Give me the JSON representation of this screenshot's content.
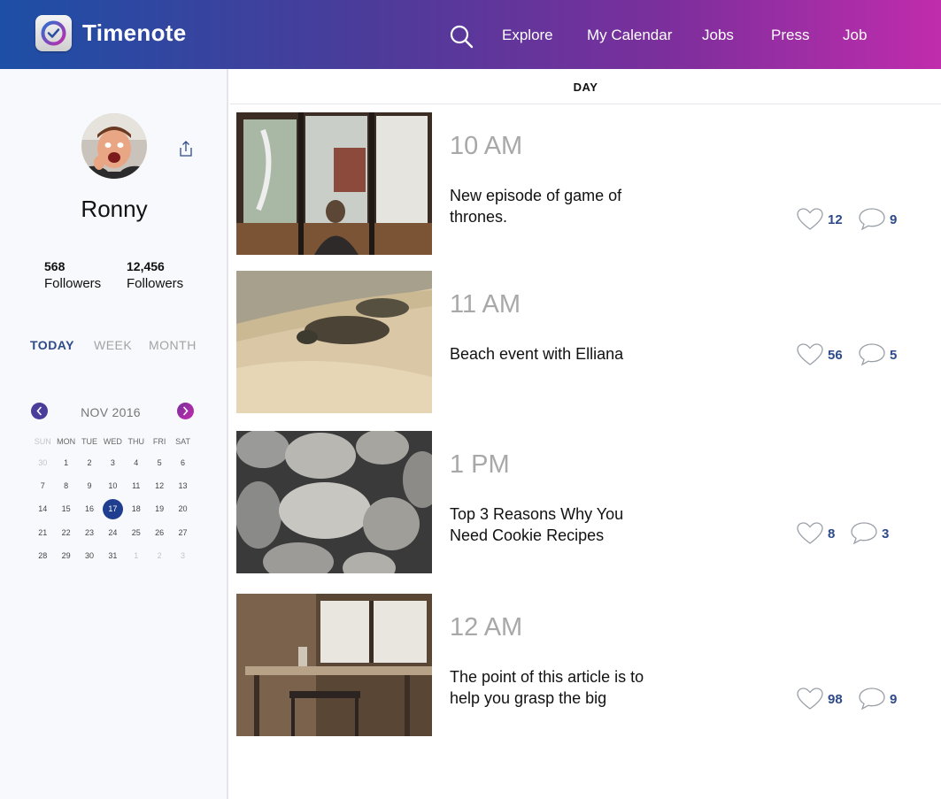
{
  "app": {
    "brand": "Timenote"
  },
  "nav": {
    "items": [
      {
        "label": "Explore"
      },
      {
        "label": "My Calendar"
      },
      {
        "label": "Jobs"
      },
      {
        "label": "Press"
      },
      {
        "label": "Job"
      }
    ],
    "search_icon": "search-icon"
  },
  "profile": {
    "name": "Ronny",
    "stats": [
      {
        "value": "568",
        "label": "Followers"
      },
      {
        "value": "12,456",
        "label": "Followers"
      }
    ]
  },
  "range_tabs": [
    {
      "label": "TODAY",
      "active": true
    },
    {
      "label": "WEEK",
      "active": false
    },
    {
      "label": "MONTH",
      "active": false
    }
  ],
  "calendar": {
    "month_label": "NOV 2016",
    "weekdays": [
      "SUN",
      "MON",
      "TUE",
      "WED",
      "THU",
      "FRI",
      "SAT"
    ],
    "weeks": [
      [
        "30",
        "1",
        "2",
        "3",
        "4",
        "5",
        "6"
      ],
      [
        "7",
        "8",
        "9",
        "10",
        "11",
        "12",
        "13"
      ],
      [
        "14",
        "15",
        "16",
        "17",
        "18",
        "19",
        "20"
      ],
      [
        "21",
        "22",
        "23",
        "24",
        "25",
        "26",
        "27"
      ],
      [
        "28",
        "29",
        "30",
        "31",
        "1",
        "2",
        "3"
      ]
    ],
    "selected_day": "17"
  },
  "main": {
    "view_label": "DAY",
    "events": [
      {
        "time": "10 AM",
        "title": "New episode of game of thrones.",
        "likes": "12",
        "comments": "9",
        "image": "window-portrait-photo"
      },
      {
        "time": "11 AM",
        "title": "Beach event with Elliana",
        "likes": "56",
        "comments": "5",
        "image": "sea-turtles-photo"
      },
      {
        "time": "1 PM",
        "title": "Top 3 Reasons Why You Need Cookie Recipes",
        "likes": "8",
        "comments": "3",
        "image": "pebbles-photo"
      },
      {
        "time": "12 AM",
        "title": "The point of this article is to help you grasp the big",
        "likes": "98",
        "comments": "9",
        "image": "cafe-table-photo"
      }
    ]
  },
  "colors": {
    "header_gradient_start": "#1d4fa6",
    "header_gradient_end": "#c02cac",
    "active_tab": "#2d4a8a",
    "selected_day": "#1f3e8f",
    "count_text": "#2d4a8a"
  }
}
